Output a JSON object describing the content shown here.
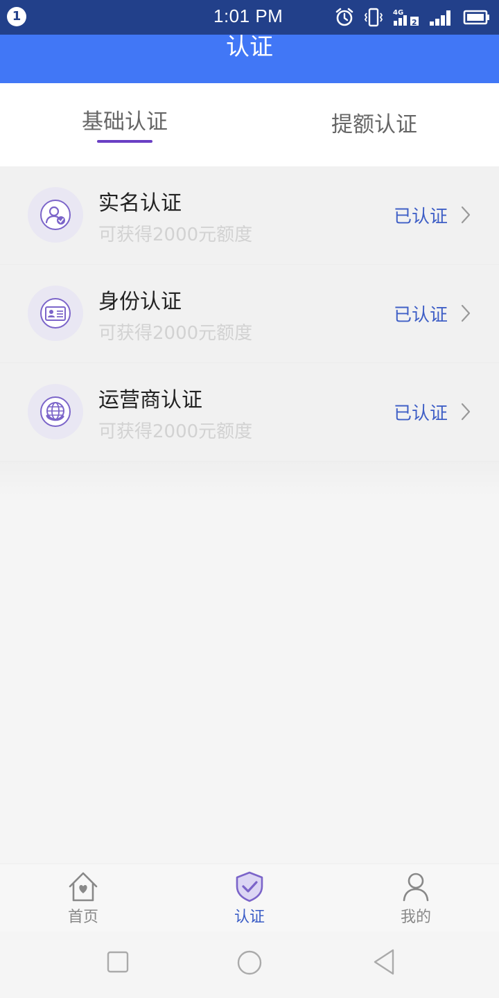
{
  "status_bar": {
    "badge": "1",
    "time": "1:01 PM",
    "network_label": "4G",
    "sim_slot": "2",
    "icons": [
      "alarm-icon",
      "vibrate-icon",
      "signal-4g-icon",
      "signal-icon",
      "battery-icon"
    ]
  },
  "header": {
    "title": "认证"
  },
  "tabs": [
    {
      "label": "基础认证",
      "active": true
    },
    {
      "label": "提额认证",
      "active": false
    }
  ],
  "cert_items": [
    {
      "title": "实名认证",
      "subtitle": "可获得2000元额度",
      "status": "已认证",
      "icon": "user-verified-icon"
    },
    {
      "title": "身份认证",
      "subtitle": "可获得2000元额度",
      "status": "已认证",
      "icon": "id-card-icon"
    },
    {
      "title": "运营商认证",
      "subtitle": "可获得2000元额度",
      "status": "已认证",
      "icon": "globe-carrier-icon"
    }
  ],
  "bottom_nav": [
    {
      "label": "首页",
      "icon": "home-icon",
      "active": false
    },
    {
      "label": "认证",
      "icon": "shield-check-icon",
      "active": true
    },
    {
      "label": "我的",
      "icon": "person-icon",
      "active": false
    }
  ],
  "colors": {
    "status_bar": "#22408a",
    "header": "#4177f6",
    "tab_indicator": "#6a3fc4",
    "status_text": "#3f5fc6",
    "icon_accent": "#7b64c9"
  }
}
